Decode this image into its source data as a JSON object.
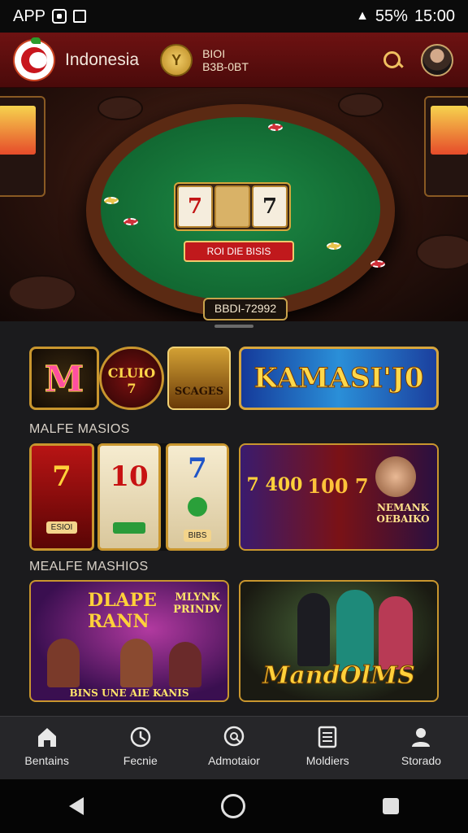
{
  "status_bar": {
    "left_label": "APP",
    "battery": "55%",
    "time": "15:00"
  },
  "header": {
    "brand": "Indonesia",
    "balance_line1": "BIOI",
    "balance_line2": "B3B-0BT"
  },
  "hero": {
    "reel1": "7",
    "reel3": "7",
    "sign": "ROI DIE BISIS",
    "plaque": "BBDI-72992"
  },
  "promo": {
    "small_tile_1": "M",
    "small_tile_2": "CLUIO 7",
    "small_tile_3": "SCAGES",
    "big_banner": "KAMASI'J0"
  },
  "sections": {
    "row1_title": "MALFE MASIOS",
    "row2_title": "MEALFE MASHIOS"
  },
  "slots_row": [
    {
      "symbol": "7",
      "caption": "ESIOI"
    },
    {
      "symbol": "10",
      "caption": ""
    },
    {
      "symbol": "7",
      "caption": "BIBS"
    }
  ],
  "slots_row2": {
    "r1": "7 400",
    "r2": "100 7",
    "side_text": "NEMANK OEBAIKO"
  },
  "games": {
    "left_line1": "DLAPE",
    "left_line2": "RANN",
    "left_side": "MLYNK PRINDV",
    "left_caption": "BINS UNE AIE KANIS",
    "right": "MandOlMS"
  },
  "nav": [
    {
      "label": "Bentains",
      "icon": "home-icon"
    },
    {
      "label": "Fecnie",
      "icon": "clock-icon"
    },
    {
      "label": "Admotaior",
      "icon": "search-icon"
    },
    {
      "label": "Moldiers",
      "icon": "list-icon"
    },
    {
      "label": "Storado",
      "icon": "profile-icon"
    }
  ],
  "colors": {
    "header": "#6e1212",
    "accent_gold": "#f0c060",
    "background": "#1b1b1d"
  }
}
